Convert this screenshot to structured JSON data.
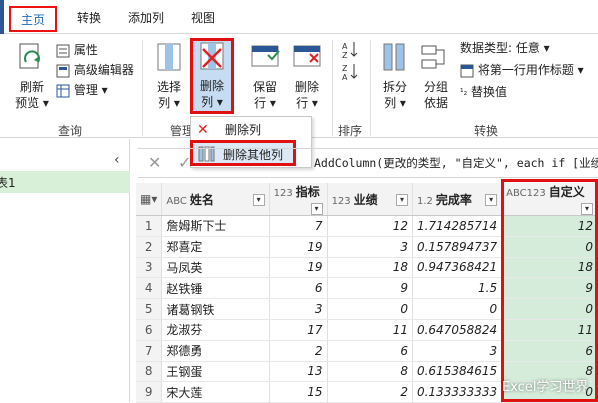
{
  "tabs": [
    {
      "label": "主页"
    },
    {
      "label": "转换"
    },
    {
      "label": "添加列"
    },
    {
      "label": "视图"
    }
  ],
  "ribbon": {
    "refresh": {
      "line1": "刷新",
      "line2": "预览"
    },
    "properties": "属性",
    "advanced_editor": "高级编辑器",
    "manage": "管理",
    "group_query": "查询",
    "choose_columns": {
      "line1": "选择",
      "line2": "列"
    },
    "delete_columns": {
      "line1": "删除",
      "line2": "列"
    },
    "group_manage_partial": "管理",
    "keep_rows": {
      "line1": "保留",
      "line2": "行"
    },
    "delete_rows": {
      "line1": "删除",
      "line2": "行"
    },
    "group_sort": "排序",
    "split_column": {
      "line1": "拆分",
      "line2": "列"
    },
    "group_by": {
      "line1": "分组",
      "line2": "依据"
    },
    "data_type": "数据类型: 任意",
    "first_row_header": "将第一行用作标题",
    "replace_values": "替换值",
    "group_transform": "转换"
  },
  "dropdown": {
    "items": [
      {
        "label": "删除列"
      },
      {
        "label": "删除其他列"
      }
    ]
  },
  "query_list": {
    "item_partial": "表1"
  },
  "formula": {
    "text": "AddColumn(更改的类型, \"自定义\", each if [业绩"
  },
  "grid": {
    "columns": [
      {
        "type": "ABC",
        "name": "姓名"
      },
      {
        "type": "123",
        "name": "指标"
      },
      {
        "type": "123",
        "name": "业绩"
      },
      {
        "type": "1.2",
        "name": "完成率"
      },
      {
        "type": "ABC123",
        "name": "自定义"
      }
    ],
    "rows": [
      {
        "n": "1",
        "name": "詹姆斯下士",
        "target": "7",
        "sales": "12",
        "rate": "1.714285714",
        "custom": "12"
      },
      {
        "n": "2",
        "name": "郑喜定",
        "target": "19",
        "sales": "3",
        "rate": "0.157894737",
        "custom": "0"
      },
      {
        "n": "3",
        "name": "马凤英",
        "target": "19",
        "sales": "18",
        "rate": "0.947368421",
        "custom": "18"
      },
      {
        "n": "4",
        "name": "赵铁锤",
        "target": "6",
        "sales": "9",
        "rate": "1.5",
        "custom": "9"
      },
      {
        "n": "5",
        "name": "诸葛钢铁",
        "target": "3",
        "sales": "0",
        "rate": "0",
        "custom": "0"
      },
      {
        "n": "6",
        "name": "龙淑芬",
        "target": "17",
        "sales": "11",
        "rate": "0.647058824",
        "custom": "11"
      },
      {
        "n": "7",
        "name": "郑德勇",
        "target": "2",
        "sales": "6",
        "rate": "3",
        "custom": "6"
      },
      {
        "n": "8",
        "name": "王钢蛋",
        "target": "13",
        "sales": "8",
        "rate": "0.615384615",
        "custom": "8"
      },
      {
        "n": "9",
        "name": "宋大莲",
        "target": "15",
        "sales": "2",
        "rate": "0.133333333",
        "custom": "0"
      }
    ]
  },
  "watermark": "Excel学习世界",
  "colors": {
    "accent": "#1e6bb8",
    "highlight": "#e01010",
    "custom_col": "#d4ecd9"
  }
}
